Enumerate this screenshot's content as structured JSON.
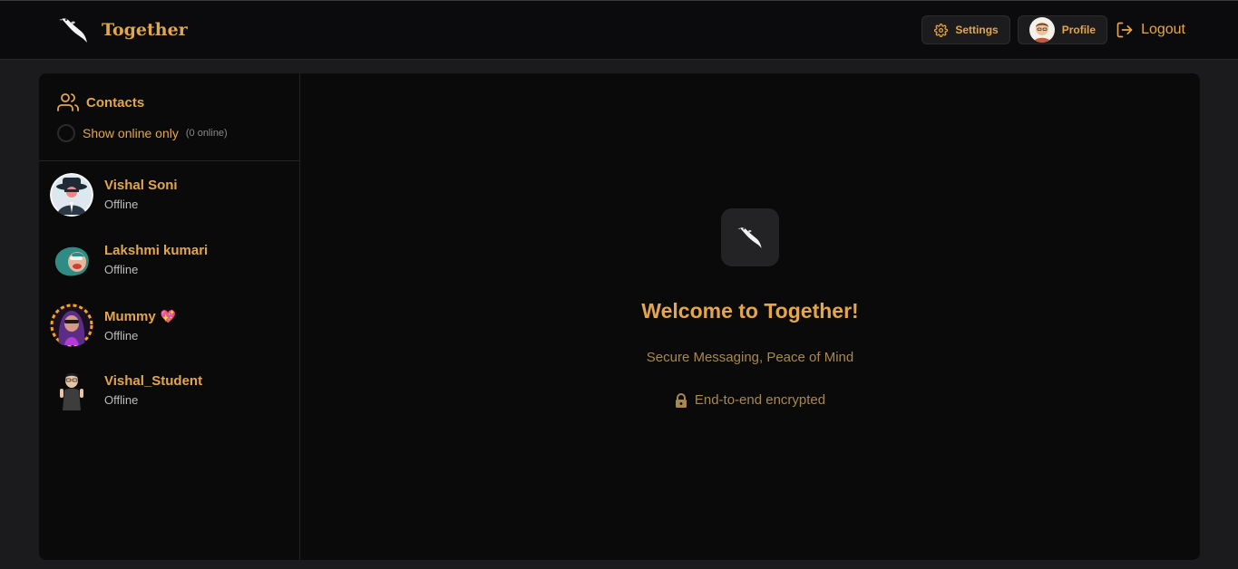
{
  "app": {
    "name": "Together"
  },
  "header": {
    "settings_label": "Settings",
    "profile_label": "Profile",
    "logout_label": "Logout"
  },
  "sidebar": {
    "title": "Contacts",
    "online_toggle_label": "Show online only",
    "online_count": "(0 online)",
    "contacts": [
      {
        "name": "Vishal Soni",
        "status": "Offline",
        "avatar": "hat-spy-avatar"
      },
      {
        "name": "Lakshmi kumari",
        "status": "Offline",
        "avatar": "teal-hair-avatar"
      },
      {
        "name": "Mummy",
        "status": "Offline",
        "avatar": "neon-girl-avatar",
        "emoji": "💖"
      },
      {
        "name": "Vishal_Student",
        "status": "Offline",
        "avatar": "bitmoji-student-avatar"
      }
    ]
  },
  "main": {
    "welcome_title": "Welcome to Together!",
    "tagline": "Secure Messaging, Peace of Mind",
    "encrypted_label": "End-to-end encrypted"
  },
  "colors": {
    "accent": "#e3a64c",
    "background": "#1b1b1d",
    "panel": "#0a0a0a",
    "muted_text": "#a9884f"
  }
}
